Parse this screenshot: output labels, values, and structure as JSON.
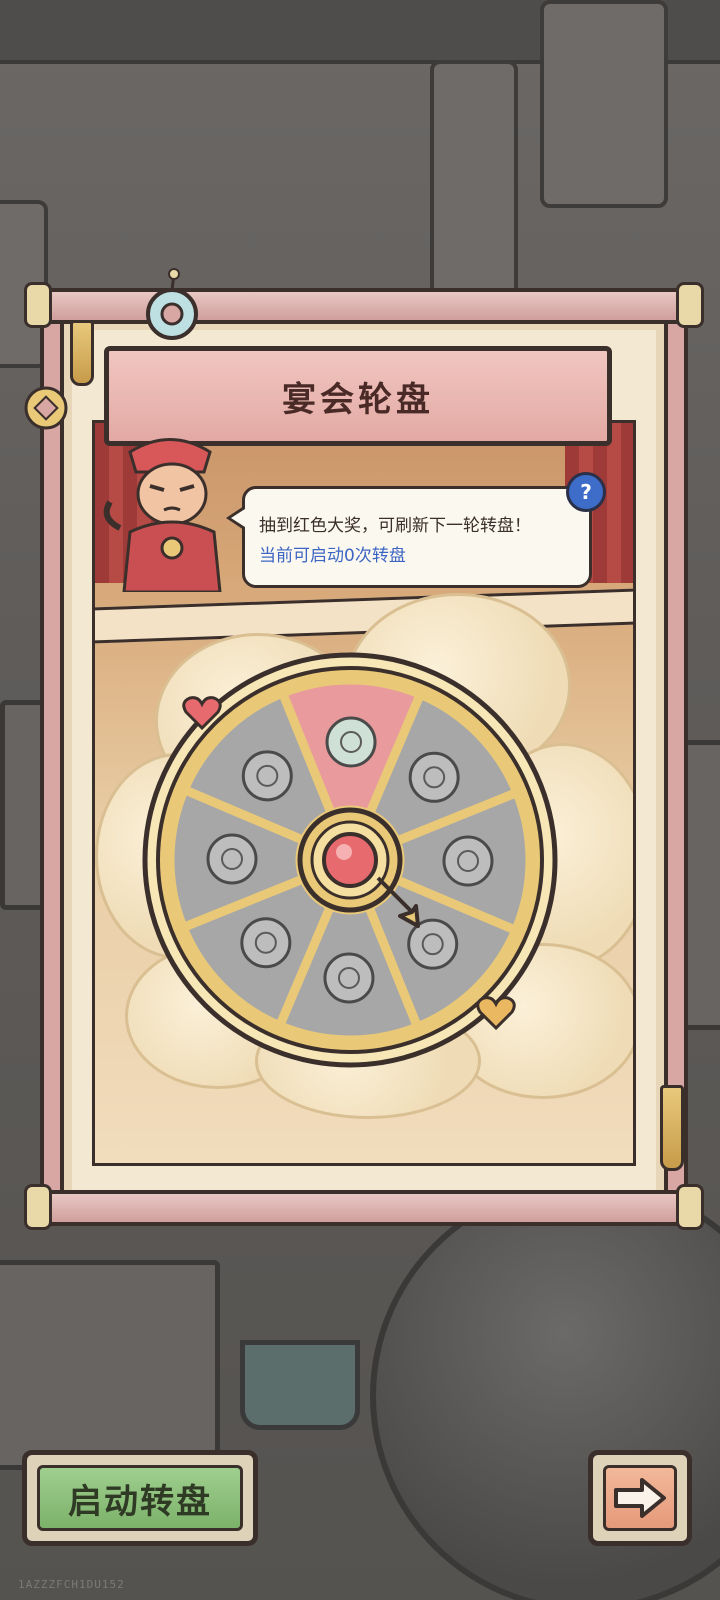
{
  "panel": {
    "title": "宴会轮盘"
  },
  "bubble": {
    "hint": "抽到红色大奖，可刷新下一轮转盘！",
    "status": "当前可启动0次转盘",
    "help_icon": "question-mark-icon"
  },
  "wheel": {
    "segments": [
      {
        "icon": "painting-icon",
        "highlight": true
      },
      {
        "icon": "ghost-icon",
        "highlight": false
      },
      {
        "icon": "coin-pile-icon",
        "highlight": false
      },
      {
        "icon": "yin-yang-icon",
        "highlight": false
      },
      {
        "icon": "gold-ingot-icon",
        "highlight": false
      },
      {
        "icon": "ghost-cloak-icon",
        "highlight": false
      },
      {
        "icon": "brush-icon",
        "highlight": false
      },
      {
        "icon": "ticket-icon",
        "highlight": false
      }
    ],
    "center_icon": "spin-button-icon",
    "colors": {
      "highlight": "#e99a9c",
      "normal": "#a7a7a7",
      "rim": "#e9c978"
    }
  },
  "buttons": {
    "start_label": "启动转盘",
    "next_icon": "arrow-right-icon"
  },
  "watermark": "1AZZZFCH1DU152"
}
